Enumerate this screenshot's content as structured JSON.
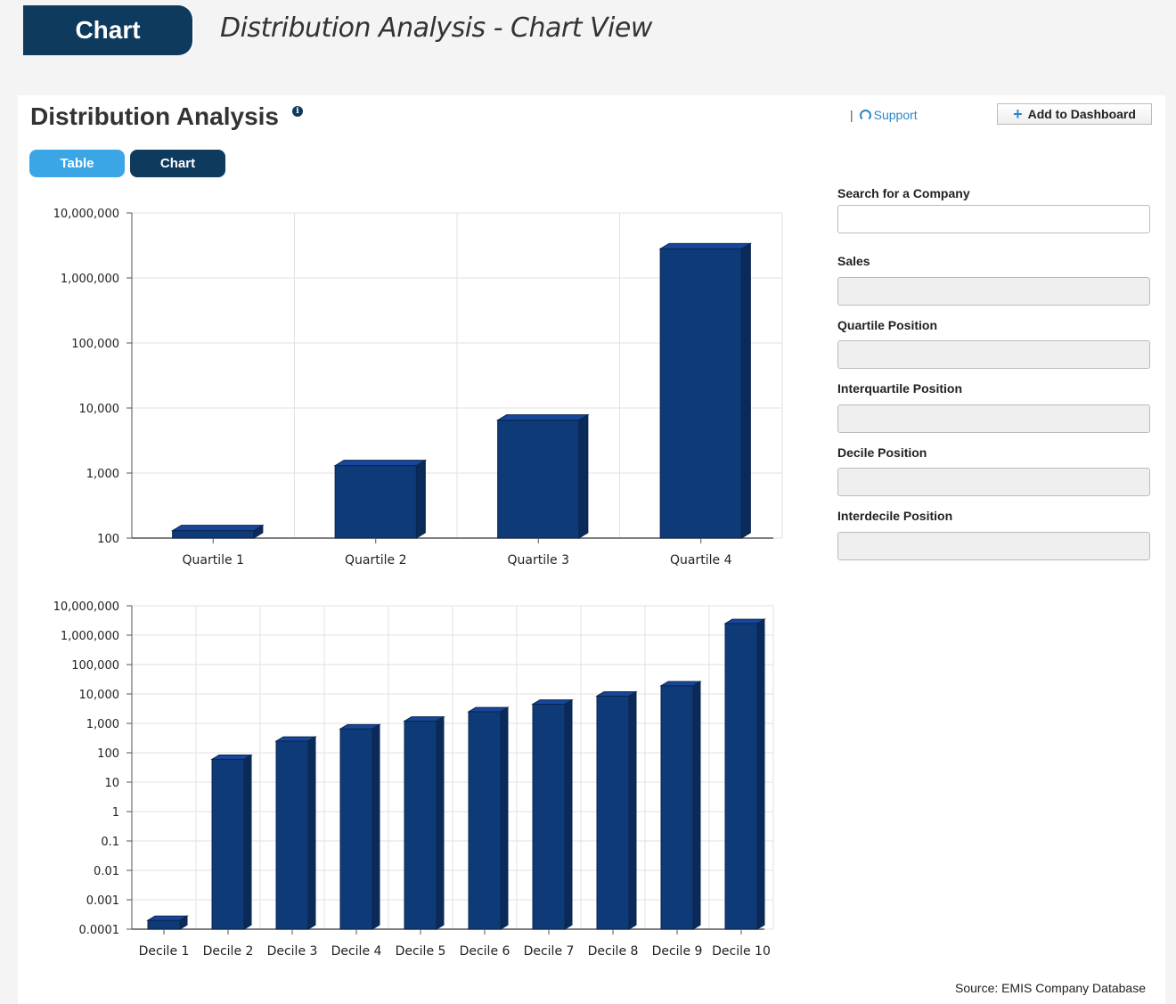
{
  "header": {
    "badge": "Chart",
    "caption": "Distribution Analysis - Chart View"
  },
  "panel": {
    "title": "Distribution Analysis",
    "info_icon": "i",
    "tabs": [
      {
        "label": "Table",
        "active": false
      },
      {
        "label": "Chart",
        "active": true
      }
    ],
    "support_label": "Support",
    "support_separator": "|",
    "add_dashboard_label": "Add to Dashboard"
  },
  "form": {
    "search_label": "Search for a Company",
    "search_value": "",
    "sales_label": "Sales",
    "quartile_label": "Quartile Position",
    "interquartile_label": "Interquartile Position",
    "decile_label": "Decile Position",
    "interdecile_label": "Interdecile Position"
  },
  "source": "Source: EMIS Company Database",
  "colors": {
    "bar": "#0f3a78",
    "bar_top": "#16479a",
    "bar_side": "#0a2a5a",
    "header_bg": "#0e3a5e",
    "tab_active": "#0e3a5e",
    "tab_inactive": "#3aa6e6",
    "link": "#2a86c8"
  },
  "chart_data": [
    {
      "type": "bar",
      "y_scale": "log",
      "ylim": [
        100,
        10000000
      ],
      "y_ticks": [
        "100",
        "1,000",
        "10,000",
        "100,000",
        "1,000,000",
        "10,000,000"
      ],
      "categories": [
        "Quartile 1",
        "Quartile 2",
        "Quartile 3",
        "Quartile 4"
      ],
      "values": [
        130,
        1300,
        6500,
        2800000
      ],
      "grid": true
    },
    {
      "type": "bar",
      "y_scale": "log",
      "ylim": [
        0.0001,
        10000000
      ],
      "y_ticks": [
        "0.0001",
        "0.001",
        "0.01",
        "0.1",
        "1",
        "10",
        "100",
        "1,000",
        "10,000",
        "100,000",
        "1,000,000",
        "10,000,000"
      ],
      "categories": [
        "Decile 1",
        "Decile 2",
        "Decile 3",
        "Decile 4",
        "Decile 5",
        "Decile 6",
        "Decile 7",
        "Decile 8",
        "Decile 9",
        "Decile 10"
      ],
      "values": [
        0.0002,
        60,
        250,
        650,
        1200,
        2500,
        4500,
        8500,
        19000,
        2500000
      ],
      "grid": true
    }
  ]
}
